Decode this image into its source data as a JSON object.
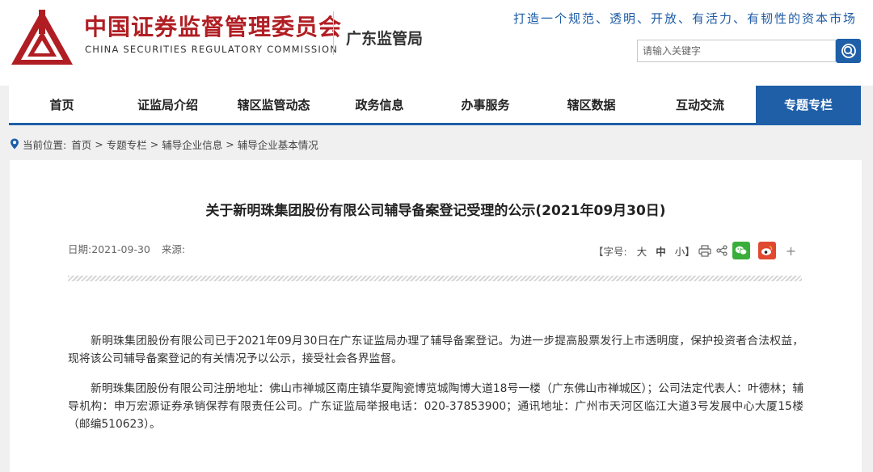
{
  "header": {
    "logo_cn": "中国证券监督管理委员会",
    "logo_en": "CHINA SECURITIES REGULATORY COMMISSION",
    "bureau": "广东监管局",
    "slogan": "打造一个规范、透明、开放、有活力、有韧性的资本市场",
    "search_placeholder": "请输入关键字",
    "brand_red": "#b01e23",
    "brand_blue": "#1f5fa8"
  },
  "nav": {
    "items": [
      {
        "label": "首页",
        "icon": ""
      },
      {
        "label": "证监局介绍"
      },
      {
        "label": "辖区监管动态"
      },
      {
        "label": "政务信息"
      },
      {
        "label": "办事服务"
      },
      {
        "label": "辖区数据"
      },
      {
        "label": "互动交流"
      },
      {
        "label": "专题专栏",
        "active": true
      }
    ]
  },
  "breadcrumb": {
    "prefix": "当前位置:",
    "items": [
      "首页",
      "专题专栏",
      "辅导企业信息",
      "辅导企业基本情况"
    ],
    "separator": ">"
  },
  "article": {
    "title": "关于新明珠集团股份有限公司辅导备案登记受理的公示(2021年09月30日)",
    "date_label": "日期:",
    "date": "2021-09-30",
    "source_label": "来源:",
    "font_size_label": "【字号:",
    "font_large": "大",
    "font_medium": "中",
    "font_small": "小】",
    "paragraphs": [
      "新明珠集团股份有限公司已于2021年09月30日在广东证监局办理了辅导备案登记。为进一步提高股票发行上市透明度，保护投资者合法权益，现将该公司辅导备案登记的有关情况予以公示，接受社会各界监督。",
      "新明珠集团股份有限公司注册地址：佛山市禅城区南庄镇华夏陶瓷博览城陶博大道18号一楼（广东佛山市禅城区）；公司法定代表人：叶德林；辅导机构：申万宏源证券承销保荐有限责任公司。广东证监局举报电话：020-37853900；通讯地址：广州市天河区临江大道3号发展中心大厦15楼（邮编510623）。"
    ]
  }
}
